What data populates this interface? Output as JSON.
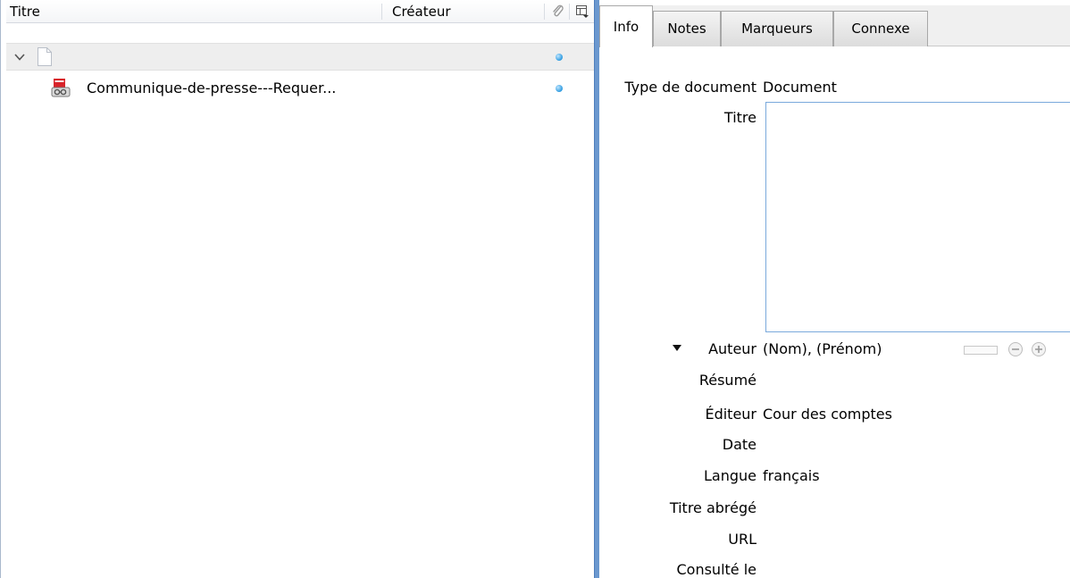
{
  "items_list": {
    "columns": {
      "title": "Titre",
      "creator": "Créateur"
    },
    "rows": [
      {
        "type": "parent",
        "title": ""
      },
      {
        "type": "attachment",
        "title": "Communique-de-presse---Requer..."
      }
    ],
    "icons": {
      "attachment_column": "paperclip-icon",
      "column_picker": "column-picker-icon",
      "parent_item": "document-icon",
      "child_item": "pdf-attachment-icon",
      "status": "blue-dot-icon"
    },
    "status_color": "#2f9be0"
  },
  "item_pane": {
    "tabs": [
      {
        "label": "Info",
        "active": true
      },
      {
        "label": "Notes",
        "active": false
      },
      {
        "label": "Marqueurs",
        "active": false
      },
      {
        "label": "Connexe",
        "active": false
      }
    ],
    "fields": {
      "item_type": {
        "label": "Type de document",
        "value": "Document"
      },
      "title": {
        "label": "Titre",
        "value": ""
      },
      "author": {
        "label": "Auteur",
        "value": "(Nom), (Prénom)"
      },
      "abstract": {
        "label": "Résumé",
        "value": ""
      },
      "publisher": {
        "label": "Éditeur",
        "value": "Cour des comptes"
      },
      "date": {
        "label": "Date",
        "value": ""
      },
      "language": {
        "label": "Langue",
        "value": "français"
      },
      "short_title": {
        "label": "Titre abrégé",
        "value": ""
      },
      "url": {
        "label": "URL",
        "value": ""
      },
      "accessed": {
        "label": "Consulté le",
        "value": ""
      }
    }
  },
  "colors": {
    "splitter": "#6b98cf",
    "title_box_border": "#7aa9dc",
    "tab_strip": "#f0f0f0"
  }
}
